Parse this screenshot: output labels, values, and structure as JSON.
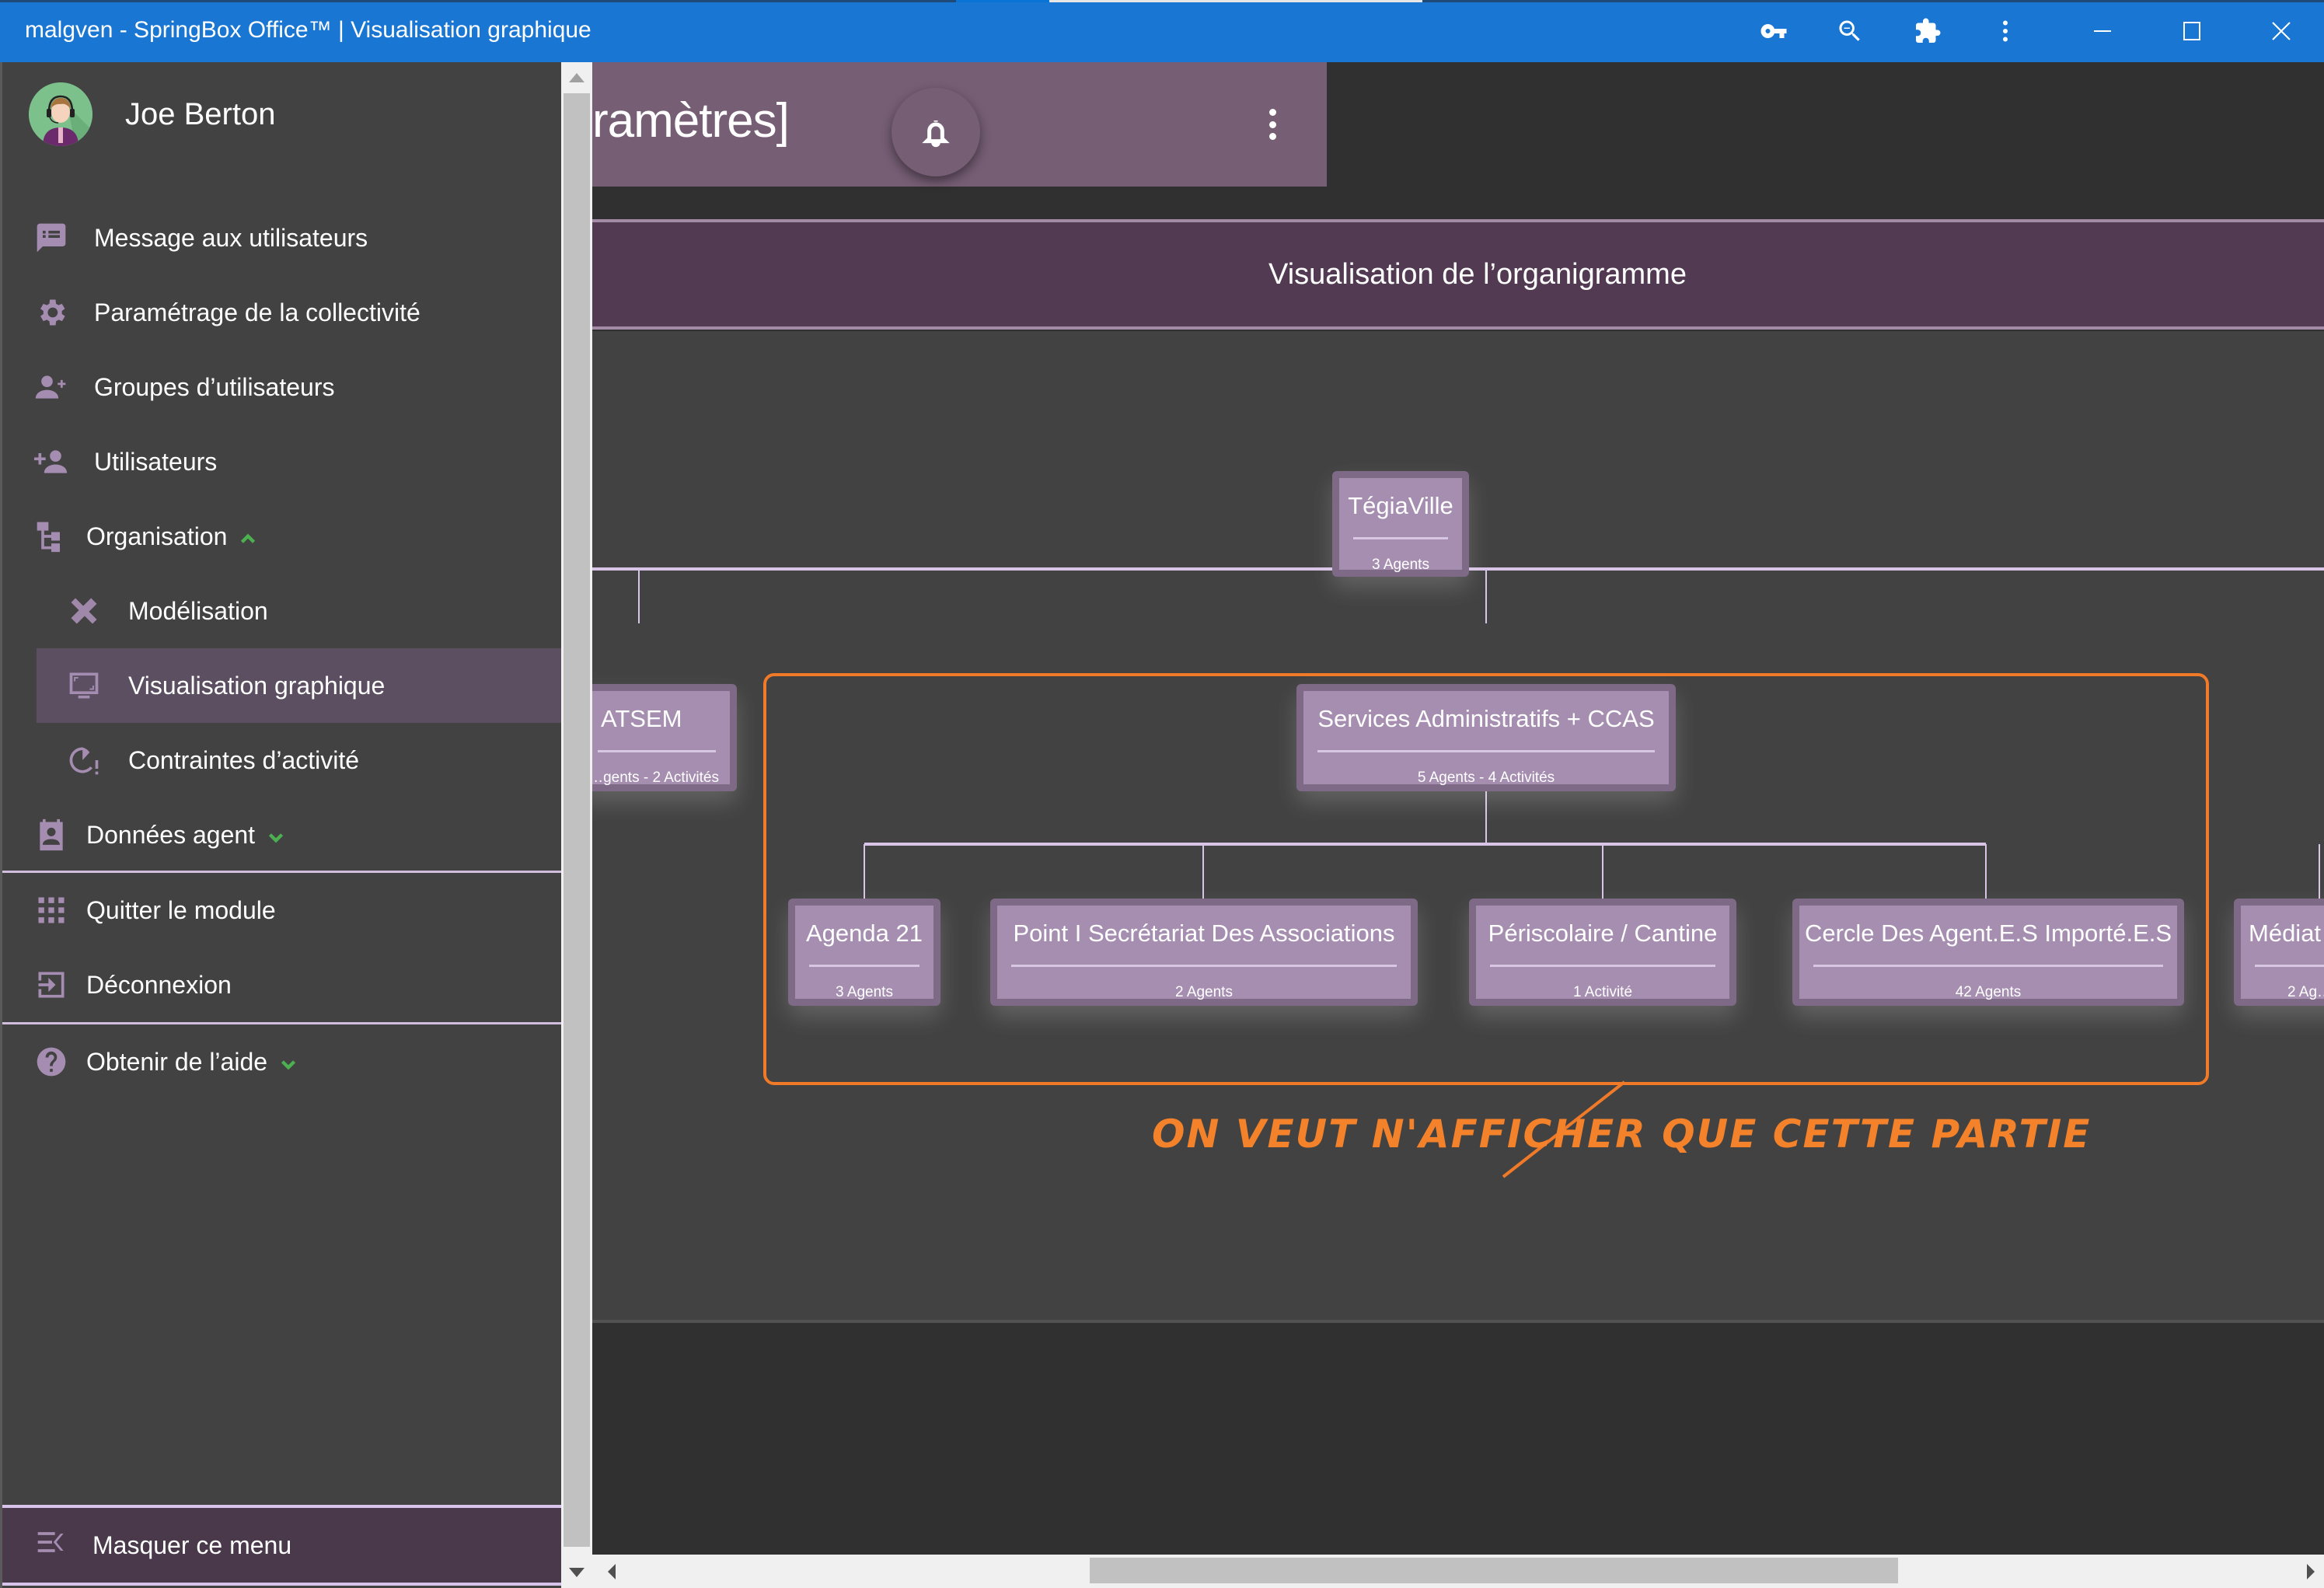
{
  "window": {
    "title": "malgven - SpringBox Office™ | Visualisation graphique",
    "toolbar_icons": [
      "key-icon",
      "zoom-out-icon",
      "puzzle-icon",
      "more-vert-icon"
    ],
    "controls": [
      "minimize",
      "maximize",
      "close"
    ]
  },
  "sidebar": {
    "user_name": "Joe Berton",
    "items": [
      {
        "label": "Message aux utilisateurs",
        "icon": "message-icon"
      },
      {
        "label": "Paramétrage de la collectivité",
        "icon": "gear-icon"
      },
      {
        "label": "Groupes d’utilisateurs",
        "icon": "group-add-icon"
      },
      {
        "label": "Utilisateurs",
        "icon": "person-add-icon"
      },
      {
        "label": "Organisation",
        "icon": "org-tree-icon",
        "expanded": true
      },
      {
        "label": "Modélisation",
        "icon": "design-tools-icon",
        "sub": true
      },
      {
        "label": "Visualisation graphique",
        "icon": "screen-icon",
        "sub": true,
        "active": true
      },
      {
        "label": "Contraintes d’activité",
        "icon": "timer-alert-icon",
        "sub": true
      },
      {
        "label": "Données agent",
        "icon": "contact-card-icon",
        "expanded": false
      },
      {
        "label": "Quitter le module",
        "icon": "apps-grid-icon"
      },
      {
        "label": "Déconnexion",
        "icon": "logout-icon"
      },
      {
        "label": "Obtenir de l’aide",
        "icon": "help-icon",
        "expanded": false
      }
    ],
    "hide_menu_label": "Masquer ce menu"
  },
  "header": {
    "breadcrumb_visible": "ramètres]"
  },
  "section": {
    "title": "Visualisation de l’organigramme"
  },
  "org_chart": {
    "root": {
      "name": "TégiaVille",
      "info": "3 Agents"
    },
    "level1": [
      {
        "name": "ATSEM",
        "info": "…gents - 2 Activités"
      },
      {
        "name": "Services Administratifs + CCAS",
        "info": "5 Agents - 4 Activités"
      },
      {
        "name": "Médiat…",
        "info": "2 Ag…"
      }
    ],
    "level2": [
      {
        "name": "Agenda 21",
        "info": "3 Agents"
      },
      {
        "name": "Point I Secrétariat Des Associations",
        "info": "2 Agents"
      },
      {
        "name": "Périscolaire / Cantine",
        "info": "1 Activité"
      },
      {
        "name": "Cercle Des Agent.E.S Importé.E.S",
        "info": "42 Agents"
      }
    ]
  },
  "annotation": {
    "text": "ON VEUT N'AFFICHER QUE CETTE PARTIE",
    "color": "#f4822a"
  },
  "colors": {
    "titlebar": "#1976D2",
    "sidebar_bg": "#424242",
    "accent_purple": "#a68eb1",
    "header_card": "#765E75",
    "section_bar": "#533A53",
    "chevron_green": "#4caf50"
  }
}
